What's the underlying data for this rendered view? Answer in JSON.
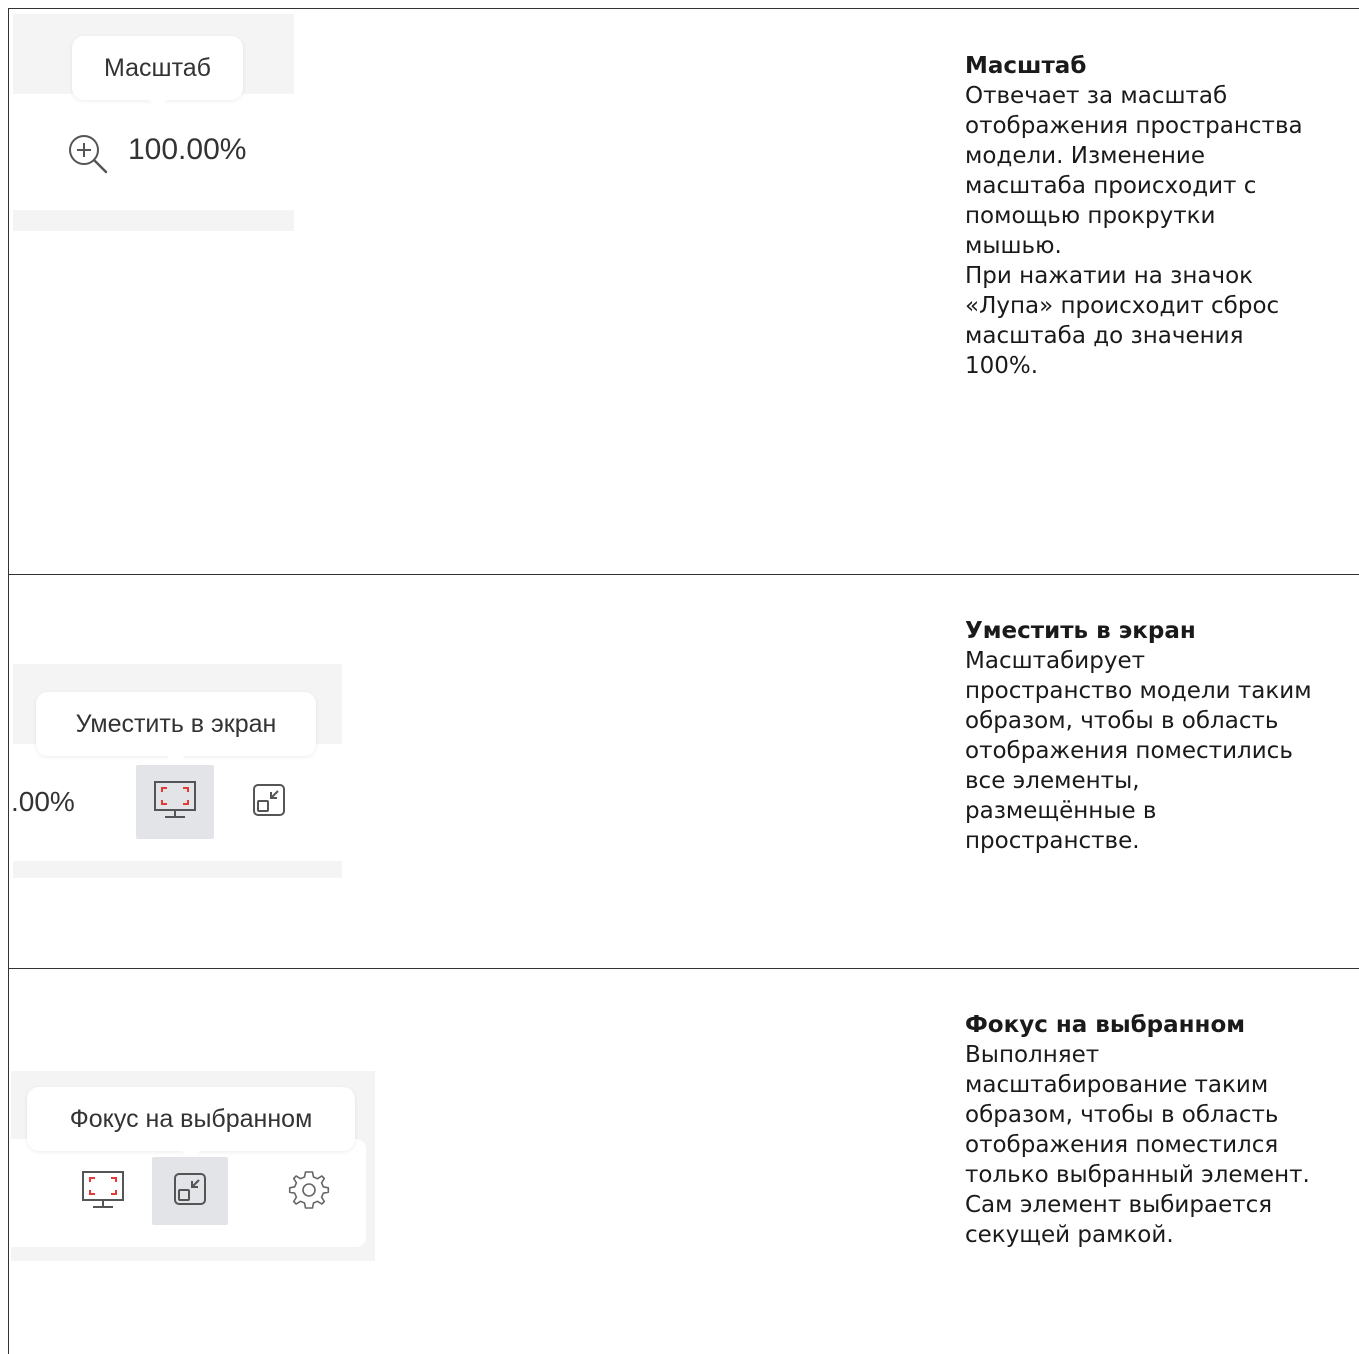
{
  "rows": [
    {
      "tooltip": "Масштаб",
      "zoom_value": "100.00%",
      "title": "Масштаб",
      "lines": [
        "Отвечает за масштаб",
        "отображения пространства",
        "модели. Изменение",
        "масштаба происходит с",
        "помощью прокрутки",
        "мышью.",
        "При нажатии на значок",
        "«Лупа» происходит сброс",
        "масштаба до значения",
        "100%."
      ]
    },
    {
      "tooltip": "Уместить в экран",
      "zoom_value_partial": ".00%",
      "title": "Уместить в экран",
      "lines": [
        "Масштабирует",
        "пространство модели таким",
        "образом, чтобы в область",
        "отображения поместились",
        "все элементы,",
        "размещённые в",
        "пространстве."
      ]
    },
    {
      "tooltip": "Фокус на выбранном",
      "title": "Фокус на выбранном",
      "lines": [
        "Выполняет",
        "масштабирование таким",
        "образом, чтобы в область",
        "отображения поместился",
        "только выбранный элемент.",
        "Сам элемент выбирается",
        "секущей рамкой."
      ]
    }
  ],
  "colors": {
    "accent_red": "#e53935",
    "icon_gray": "#555555",
    "active_bg": "#e2e4e8"
  }
}
